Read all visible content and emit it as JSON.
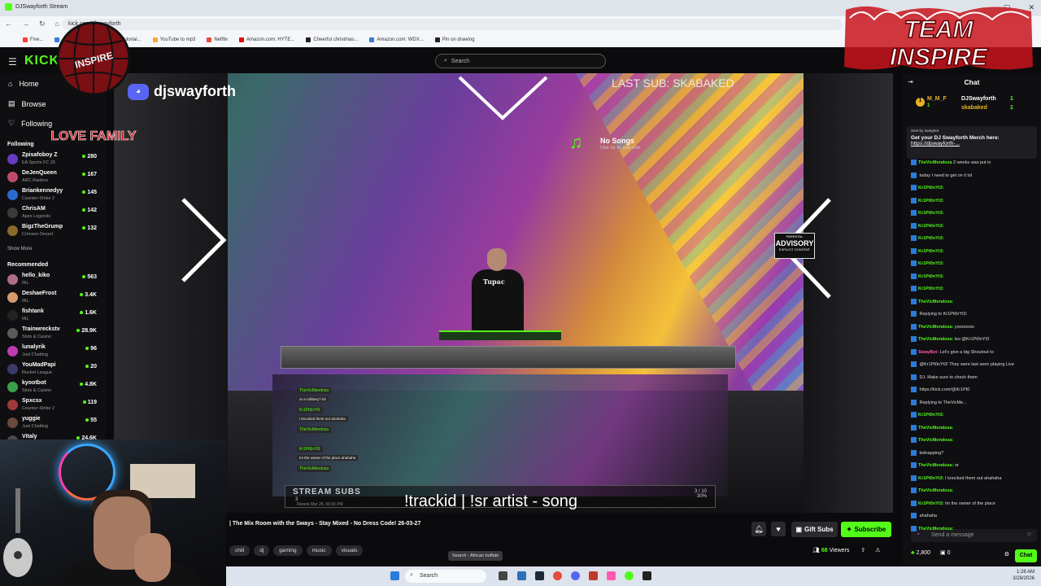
{
  "browser": {
    "tab_title": "DJSwayforth Stream",
    "url": "kick.com/djswayforth",
    "bookmarks": [
      "Five...",
      "...mail",
      "Sony Vegas Tutorial...",
      "YouTube to mp3",
      "Netflix",
      "Amazon.com: HYTE...",
      "Cheerful christmas...",
      "Amazon.com: WDX...",
      "Pin on drawing"
    ]
  },
  "kick": {
    "logo": "KICK",
    "search_placeholder": "Search",
    "nav": [
      {
        "label": "Home",
        "icon": "home-icon"
      },
      {
        "label": "Browse",
        "icon": "browse-icon"
      },
      {
        "label": "Following",
        "icon": "heart-icon"
      }
    ],
    "following_header": "Following",
    "following": [
      {
        "name": "Zpisafoboy Z",
        "game": "EA Sports FC 26",
        "viewers": "280",
        "color": "#6a3ac0"
      },
      {
        "name": "DeJenQueen",
        "game": "ARC Raiders",
        "viewers": "167",
        "color": "#c04a6a"
      },
      {
        "name": "Briankennedyy",
        "game": "Counter-Strike 2",
        "viewers": "145",
        "color": "#2a6ad0"
      },
      {
        "name": "ChrisAM",
        "game": "Apex Legends",
        "viewers": "142",
        "color": "#3a3a3a"
      },
      {
        "name": "BigzTheGrump",
        "game": "Crimson Desert",
        "viewers": "132",
        "color": "#8a6a2a"
      }
    ],
    "show_more": "Show More",
    "recommended_header": "Recommended",
    "recommended": [
      {
        "name": "hello_kiko",
        "game": "IRL",
        "viewers": "563",
        "color": "#b06a8a"
      },
      {
        "name": "DeshaeFrost",
        "game": "IRL",
        "viewers": "3.4K",
        "color": "#d89a6a"
      },
      {
        "name": "fishtank",
        "game": "IRL",
        "viewers": "1.6K",
        "color": "#222"
      },
      {
        "name": "Trainwreckstv",
        "game": "Slots & Casino",
        "viewers": "28.9K",
        "color": "#5a5a5a"
      },
      {
        "name": "lunalyrik",
        "game": "Just Chatting",
        "viewers": "96",
        "color": "#c03ab0"
      },
      {
        "name": "YouMadPapi",
        "game": "Rocket League",
        "viewers": "20",
        "color": "#3a3a6a"
      },
      {
        "name": "kyootbot",
        "game": "Slots & Casino",
        "viewers": "4.8K",
        "color": "#3aa04a"
      },
      {
        "name": "Spxcsx",
        "game": "Counter-Strike 2",
        "viewers": "119",
        "color": "#a03a3a"
      },
      {
        "name": "yuggie",
        "game": "Just Chatting",
        "viewers": "55",
        "color": "#6a4a3a"
      },
      {
        "name": "Vitaly",
        "game": "",
        "viewers": "24.6K",
        "color": "#4a4a4a"
      }
    ]
  },
  "video": {
    "discord_handle": "djswayforth",
    "last_sub": "LAST SUB: SKABAKED",
    "now_playing": "No Songs",
    "now_playing_sub": "Use !sr to add one",
    "advisory_top": "PARENTAL",
    "advisory_mid": "ADVISORY",
    "advisory_bottom": "EXPLICIT CONTENT",
    "shirt_text": "Tupac",
    "overlay_chat": [
      {
        "user": "TheVicMendoza",
        "msg": "or a robbery? lol"
      },
      {
        "user": "Kr1Pt0nYt3",
        "msg": "I knocked them out ahahaha"
      },
      {
        "user": "TheVicMendoza",
        "msg": ""
      },
      {
        "user": "Kr1Pt0nYt3",
        "msg": "Im the owner of the place ahahaha"
      },
      {
        "user": "TheVicMendoza",
        "msg": ""
      }
    ],
    "stream_subs_label": "STREAM SUBS",
    "stream_subs_count": "3",
    "stream_subs_date": "Resets Mar 28, 06:30 PM",
    "stream_subs_goal": "3 / 10",
    "stream_subs_pct": "30%",
    "trackid": "!trackid | !sr artist - song",
    "team_logo": "TEAM INSPIRE",
    "globe_text": "INSPIRE LOVE FAMILY"
  },
  "stream_info": {
    "title": "| The Mix Room with the Sways - Stay Mixed - No Dress Code! 26-03-27",
    "tags": [
      "chill",
      "dj",
      "gaming",
      "music",
      "visuals"
    ],
    "gift_subs": "Gift Subs",
    "subscribe": "Subscribe",
    "viewers_count": "68",
    "viewers_label": "Viewers",
    "tooltip": "Search - African buffalo"
  },
  "chat": {
    "title": "Chat",
    "top_gifters": [
      {
        "name": "M_M_F",
        "count": "1"
      },
      {
        "name": "DJSwayforth",
        "count": "1"
      },
      {
        "name": "skabaked",
        "count": "1"
      }
    ],
    "pinned_by": "Sent by SwayBot",
    "pinned_text": "Get your DJ Swayforth Merch here:",
    "pinned_link": "https://djswayforth-...",
    "messages": [
      {
        "user": "TheVicMendoza",
        "text": "2 weeks was put in",
        "color": "#53fc18"
      },
      {
        "user": "",
        "text": "today I need to get on it lol",
        "color": "#53fc18"
      },
      {
        "user": "Kr1Pt0nYt3:",
        "text": "",
        "color": "#53fc18"
      },
      {
        "user": "Kr1Pt0nYt3:",
        "text": "",
        "color": "#53fc18"
      },
      {
        "user": "Kr1Pt0nYt3:",
        "text": "",
        "color": "#53fc18"
      },
      {
        "user": "Kr1Pt0nYt3:",
        "text": "",
        "color": "#53fc18"
      },
      {
        "user": "Kr1Pt0nYt3:",
        "text": "",
        "color": "#53fc18"
      },
      {
        "user": "Kr1Pt0nYt3:",
        "text": "",
        "color": "#53fc18"
      },
      {
        "user": "Kr1Pt0nYt3:",
        "text": "",
        "color": "#53fc18"
      },
      {
        "user": "Kr1Pt0nYt3:",
        "text": "",
        "color": "#53fc18"
      },
      {
        "user": "Kr1Pt0nYt3:",
        "text": "",
        "color": "#53fc18"
      },
      {
        "user": "TheVicMendoza:",
        "text": "",
        "color": "#53fc18"
      },
      {
        "user": "",
        "text": "Replying to Kr1Pt0nYt3:",
        "color": "#888"
      },
      {
        "user": "TheVicMendoza:",
        "text": "yooooooo",
        "color": "#53fc18"
      },
      {
        "user": "TheVicMendoza:",
        "text": "lso @Kr1Pt0nYt3",
        "color": "#53fc18"
      },
      {
        "user": "SwayBot:",
        "text": "Let's give a big Shoutout to",
        "color": "#ff5ab0"
      },
      {
        "user": "",
        "text": "@Kr1Pt0nYt3! They were last seen playing Live",
        "color": "#ff5ab0"
      },
      {
        "user": "",
        "text": "DJ. Make sure to check them",
        "color": "#ff5ab0"
      },
      {
        "user": "",
        "text": "https://kick.com/@Kr1Pt0",
        "color": "#ff5ab0"
      },
      {
        "user": "",
        "text": "Replying to TheVicMe...",
        "color": "#888"
      },
      {
        "user": "Kr1Pt0nYt3:",
        "text": "",
        "color": "#53fc18"
      },
      {
        "user": "TheVicMendoza:",
        "text": "",
        "color": "#53fc18"
      },
      {
        "user": "TheVicMendoza:",
        "text": "",
        "color": "#53fc18"
      },
      {
        "user": "",
        "text": "kidnapping?",
        "color": "#53fc18"
      },
      {
        "user": "TheVicMendoza:",
        "text": "or",
        "color": "#53fc18"
      },
      {
        "user": "Kr1Pt0nYt3:",
        "text": "I knocked them out ahahaha",
        "color": "#53fc18"
      },
      {
        "user": "TheVicMendoza:",
        "text": "",
        "color": "#53fc18"
      },
      {
        "user": "Kr1Pt0nYt3:",
        "text": "Im the owner of the place",
        "color": "#53fc18"
      },
      {
        "user": "",
        "text": "ahahaha",
        "color": "#53fc18"
      },
      {
        "user": "TheVicMendoza:",
        "text": "",
        "color": "#53fc18"
      }
    ],
    "input_placeholder": "Send a message",
    "points": "2,800",
    "count": "0",
    "send": "Chat"
  },
  "taskbar": {
    "search": "Search",
    "time": "1:28 AM",
    "date": "3/28/2026"
  }
}
